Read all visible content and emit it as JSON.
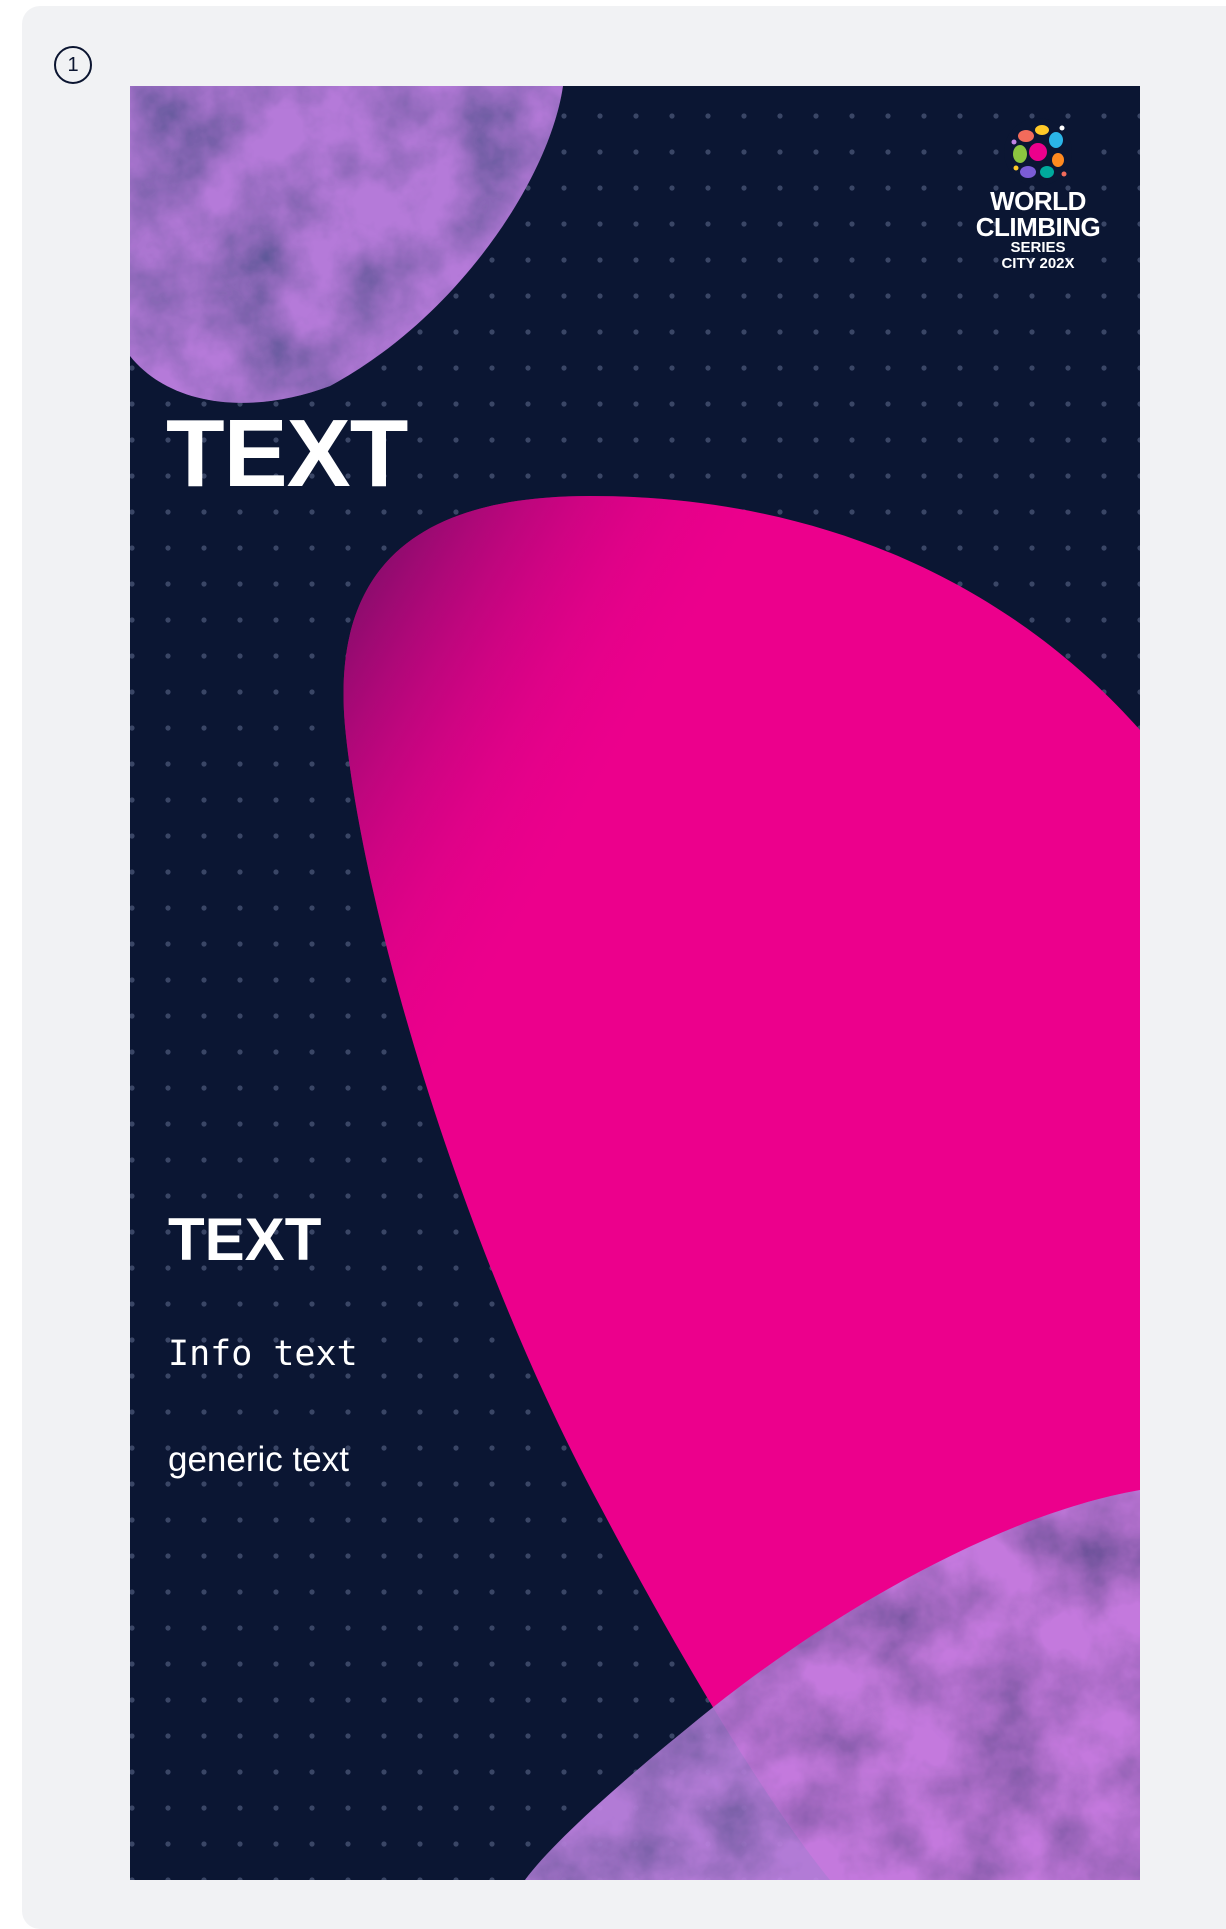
{
  "step": {
    "number": "1"
  },
  "poster": {
    "headline": "TEXT",
    "subheading": "TEXT",
    "info_text": "Info text",
    "generic_text": "generic text",
    "logo": {
      "line1": "WORLD",
      "line2": "CLIMBING",
      "line3": "SERIES",
      "line4": "CITY 202X"
    }
  },
  "colors": {
    "background": "#0b1633",
    "dots": "#3a4666",
    "magenta": "#ec008c",
    "lavender": "#c184e4"
  }
}
